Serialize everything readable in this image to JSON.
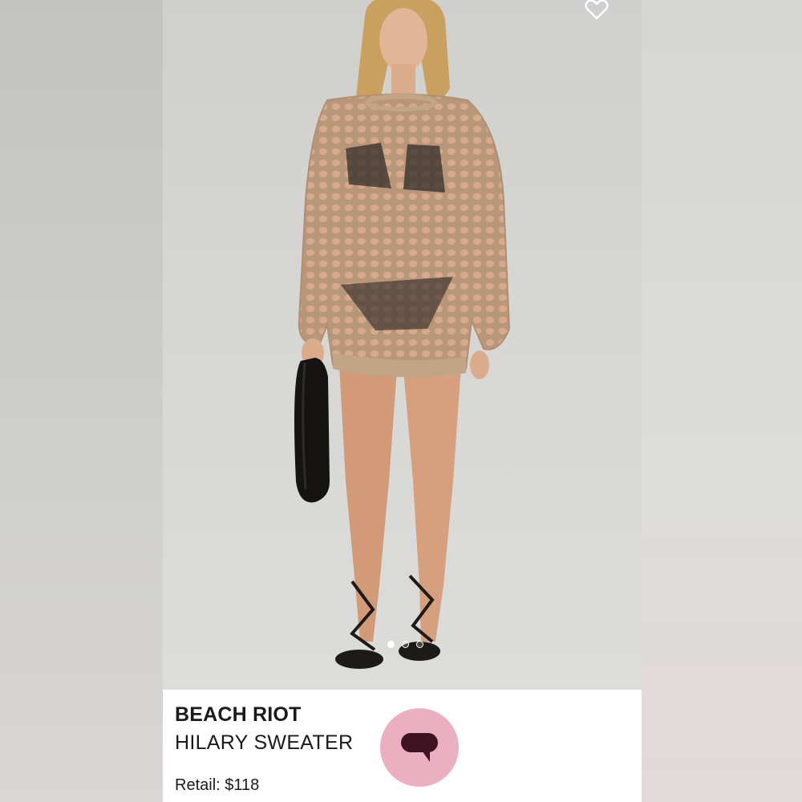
{
  "product": {
    "brand": "BEACH RIOT",
    "name": "HILARY SWEATER",
    "retail_label": "Retail: $118"
  },
  "carousel": {
    "total_slides": 3,
    "active_index": 0
  },
  "icons": {
    "favorite": "heart-icon",
    "chat": "chat-bubble-icon"
  },
  "colors": {
    "chat_button": "#ecaec1",
    "chat_icon": "#3d1322",
    "sweater": "#b99a7a"
  }
}
